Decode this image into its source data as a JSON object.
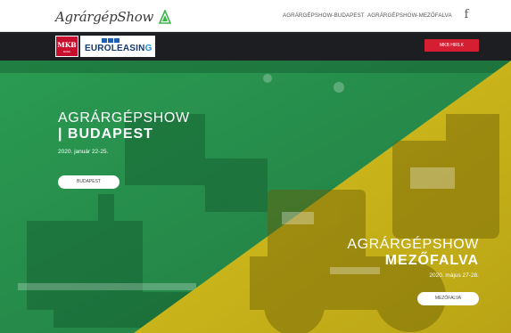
{
  "header": {
    "logo_text": "AgrárgépShow",
    "nav": [
      {
        "label": "AGRÁRGÉPSHOW-BUDAPEST"
      },
      {
        "label": "AGRÁRGÉPSHOW-MEZŐFALVA"
      }
    ],
    "social_icon": "facebook-icon",
    "social_glyph": "f"
  },
  "sponsors": {
    "mkb_text": "MKB",
    "mkb_subtext": "BANK",
    "euroleasing_text": "EUROLEASIN",
    "euroleasing_suffix": "G",
    "cta_label": "MKB HIRLK"
  },
  "hero": {
    "left": {
      "title_line1": "AGRÁRGÉPSHOW",
      "title_line2": "| BUDAPEST",
      "date": "2020. január 22-25.",
      "button": "BUDAPEST"
    },
    "right": {
      "title_line1": "AGRÁRGÉPSHOW",
      "title_line2": "MEZŐFALVA",
      "date": "2020. május 27-28.",
      "button": "MEZŐFALVA"
    }
  },
  "colors": {
    "green_overlay": "#2fae5a",
    "yellow_overlay": "#d8c21f",
    "sponsor_bar": "#1c1e22",
    "cta_red": "#d41f33"
  }
}
